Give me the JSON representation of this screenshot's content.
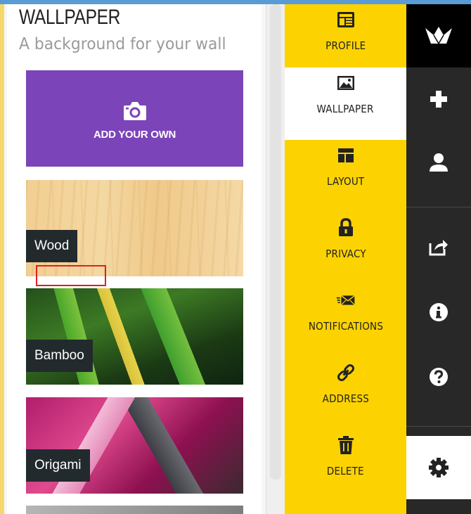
{
  "panel": {
    "title": "WALLPAPER",
    "subtitle": "A background for your wall",
    "add_label": "ADD YOUR OWN",
    "tiles": [
      {
        "name": "Wood"
      },
      {
        "name": "Bamboo"
      },
      {
        "name": "Origami"
      }
    ]
  },
  "settings_nav": {
    "items": [
      {
        "label": "PROFILE",
        "icon": "profile-card-icon"
      },
      {
        "label": "WALLPAPER",
        "icon": "image-icon",
        "active": true
      },
      {
        "label": "LAYOUT",
        "icon": "layout-icon"
      },
      {
        "label": "PRIVACY",
        "icon": "lock-icon"
      },
      {
        "label": "NOTIFICATIONS",
        "icon": "mail-icon"
      },
      {
        "label": "ADDRESS",
        "icon": "link-icon"
      },
      {
        "label": "DELETE",
        "icon": "trash-icon"
      }
    ]
  },
  "sidebar": {
    "buttons": [
      "logo-icon",
      "plus-icon",
      "user-icon",
      "share-icon",
      "info-icon",
      "help-icon",
      "gear-icon"
    ]
  },
  "colors": {
    "accent_yellow": "#fcd300",
    "add_purple": "#7b44b8",
    "sidebar_dark": "#282828"
  }
}
